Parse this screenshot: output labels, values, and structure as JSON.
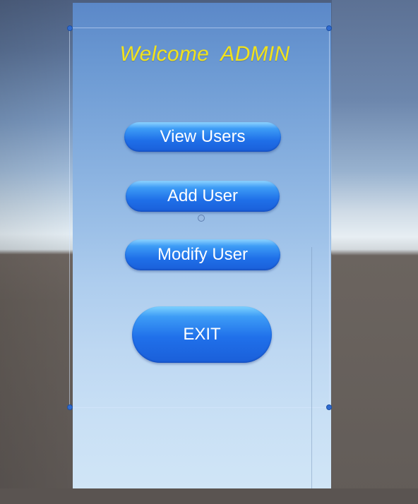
{
  "screen": {
    "title": "Welcome  ADMIN",
    "title_color": "#f2e21c"
  },
  "menu": {
    "view_users_label": "View Users",
    "add_user_label": "Add User",
    "modify_user_label": "Modify User",
    "exit_label": "EXIT"
  },
  "colors": {
    "button_blue": "#1f6fe8",
    "button_highlight": "#8fd4ff",
    "panel_top": "#5b88c8",
    "panel_bottom": "#d0e5f6",
    "handle_blue": "#2f6bd0"
  },
  "editor": {
    "handle_icon": "rect-handle-dot",
    "pivot_icon": "pivot-circle-icon"
  }
}
